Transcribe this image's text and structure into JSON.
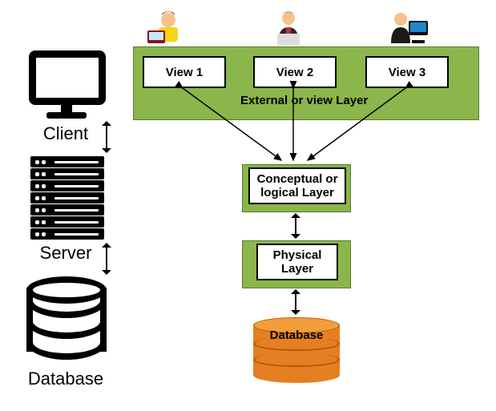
{
  "left": {
    "client": "Client",
    "server": "Server",
    "database": "Database"
  },
  "views": {
    "v1": "View 1",
    "v2": "View 2",
    "v3": "View 3",
    "caption": "External or view Layer"
  },
  "conceptual": {
    "l1": "Conceptual or",
    "l2": "logical Layer"
  },
  "physical": {
    "l1": "Physical",
    "l2": "Layer"
  },
  "db": {
    "label": "Database"
  },
  "colors": {
    "green": "#8bb64b",
    "orange": "#e67e22"
  }
}
